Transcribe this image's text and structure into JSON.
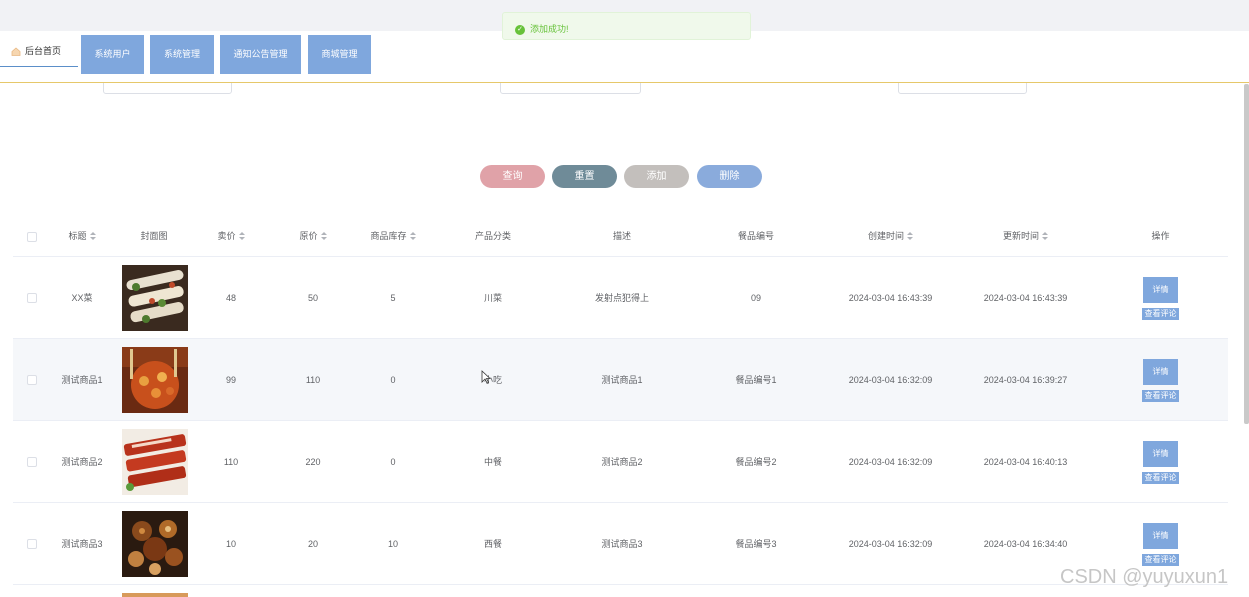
{
  "toast": {
    "message": "添加成功!",
    "icon": "check-circle-icon"
  },
  "nav": {
    "home_label": "后台首页",
    "home_icon": "house-icon",
    "buttons": [
      "系统用户",
      "系统管理",
      "通知公告管理",
      "商城管理"
    ]
  },
  "actions": {
    "query": "查询",
    "reset": "重置",
    "add": "添加",
    "delete": "删除"
  },
  "colors": {
    "query": "#e0a2a8",
    "reset": "#6f8b98",
    "add": "#c3bfbc",
    "delete": "#8aabdc",
    "primary_button": "#7fa7dd"
  },
  "table": {
    "headers": {
      "title": "标题",
      "cover": "封面图",
      "price": "卖价",
      "original_price": "原价",
      "stock": "商品库存",
      "category": "产品分类",
      "desc": "描述",
      "code": "餐品编号",
      "created": "创建时间",
      "updated": "更新时间",
      "ops": "操作"
    },
    "detail_label": "详情",
    "review_label": "查看评论",
    "rows": [
      {
        "title": "XX菜",
        "price": "48",
        "original_price": "50",
        "stock": "5",
        "category": "川菜",
        "desc": "发射点犯得上",
        "code": "09",
        "created": "2024-03-04 16:43:39",
        "updated": "2024-03-04 16:43:39"
      },
      {
        "title": "测试商品1",
        "price": "99",
        "original_price": "110",
        "stock": "0",
        "category": "小吃",
        "desc": "测试商品1",
        "code": "餐品编号1",
        "created": "2024-03-04 16:32:09",
        "updated": "2024-03-04 16:39:27"
      },
      {
        "title": "测试商品2",
        "price": "110",
        "original_price": "220",
        "stock": "0",
        "category": "中餐",
        "desc": "测试商品2",
        "code": "餐品编号2",
        "created": "2024-03-04 16:32:09",
        "updated": "2024-03-04 16:40:13"
      },
      {
        "title": "测试商品3",
        "price": "10",
        "original_price": "20",
        "stock": "10",
        "category": "西餐",
        "desc": "测试商品3",
        "code": "餐品编号3",
        "created": "2024-03-04 16:32:09",
        "updated": "2024-03-04 16:34:40"
      }
    ]
  },
  "watermark": "CSDN @yuyuxun1"
}
